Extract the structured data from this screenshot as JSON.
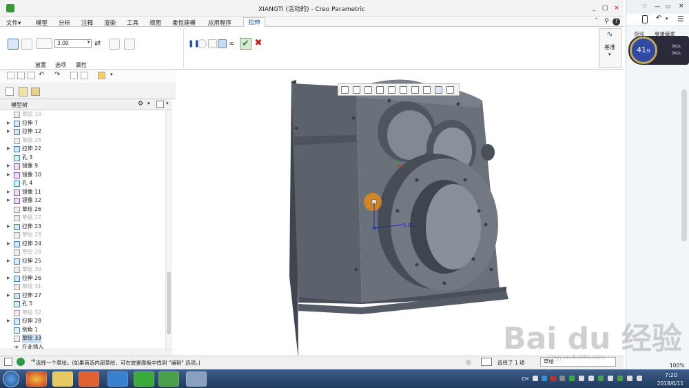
{
  "window": {
    "title": "XIANGTI (活动的) - Creo Parametric",
    "min": "_",
    "max": "□",
    "close": "×"
  },
  "menu": {
    "file": "文件▾",
    "tabs": [
      "模型",
      "分析",
      "注释",
      "渲染",
      "工具",
      "视图",
      "柔性建模",
      "应用程序"
    ],
    "active_tab": "拉伸",
    "help_icon": "question-icon",
    "search_icon": "search-icon"
  },
  "ribbon": {
    "depth_value": "3.00",
    "subtabs": [
      "放置",
      "选项",
      "属性"
    ],
    "datum_label": "基准",
    "datum_arrow": "▾",
    "ok_color": "#2a8a2a",
    "cancel_color": "#cc1111"
  },
  "tree": {
    "title": "模型树",
    "rows": [
      {
        "label": "草绘 10",
        "type": "sketch",
        "dim": true,
        "exp": ""
      },
      {
        "label": "拉伸 7",
        "type": "extrude",
        "dim": false,
        "exp": "▶"
      },
      {
        "label": "拉伸 12",
        "type": "extrude",
        "dim": false,
        "exp": "▶"
      },
      {
        "label": "草绘 25",
        "type": "sketch",
        "dim": true,
        "exp": ""
      },
      {
        "label": "拉伸 22",
        "type": "extrude",
        "dim": false,
        "exp": "▶"
      },
      {
        "label": "孔 3",
        "type": "hole",
        "dim": false,
        "exp": ""
      },
      {
        "label": "镜像 9",
        "type": "mirror",
        "dim": false,
        "exp": "▶"
      },
      {
        "label": "镜像 10",
        "type": "mirror",
        "dim": false,
        "exp": "▶"
      },
      {
        "label": "孔 4",
        "type": "hole",
        "dim": false,
        "exp": ""
      },
      {
        "label": "镜像 11",
        "type": "mirror",
        "dim": false,
        "exp": "▶"
      },
      {
        "label": "镜像 12",
        "type": "mirror",
        "dim": false,
        "exp": "▶"
      },
      {
        "label": "草绘 26",
        "type": "sketch",
        "dim": false,
        "exp": ""
      },
      {
        "label": "草绘 27",
        "type": "sketch",
        "dim": true,
        "exp": ""
      },
      {
        "label": "拉伸 23",
        "type": "extrude",
        "dim": false,
        "exp": "▶"
      },
      {
        "label": "草绘 28",
        "type": "sketch",
        "dim": true,
        "exp": ""
      },
      {
        "label": "拉伸 24",
        "type": "extrude",
        "dim": false,
        "exp": "▶"
      },
      {
        "label": "草绘 29",
        "type": "sketch",
        "dim": true,
        "exp": ""
      },
      {
        "label": "拉伸 25",
        "type": "extrude",
        "dim": false,
        "exp": "▶"
      },
      {
        "label": "草绘 30",
        "type": "sketch",
        "dim": true,
        "exp": ""
      },
      {
        "label": "拉伸 26",
        "type": "extrude",
        "dim": false,
        "exp": "▶"
      },
      {
        "label": "草绘 31",
        "type": "sketch",
        "dim": true,
        "exp": ""
      },
      {
        "label": "拉伸 27",
        "type": "extrude",
        "dim": false,
        "exp": "▶"
      },
      {
        "label": "孔 5",
        "type": "hole",
        "dim": false,
        "exp": ""
      },
      {
        "label": "草绘 32",
        "type": "sketch",
        "dim": true,
        "exp": ""
      },
      {
        "label": "拉伸 28",
        "type": "extrude",
        "dim": false,
        "exp": "▶"
      },
      {
        "label": "倒角 1",
        "type": "hole",
        "dim": false,
        "exp": ""
      },
      {
        "label": "草绘 33",
        "type": "sketch",
        "dim": false,
        "exp": "",
        "selected": true
      },
      {
        "label": "在此插入",
        "type": "insert",
        "dim": false,
        "exp": ""
      }
    ]
  },
  "canvas": {
    "dimension_value": "3.00"
  },
  "status": {
    "message": "选择一个草绘。(如果首选内部草绘，可在放置面板中找到 \"编辑\" 选项。)",
    "selected": "选择了 1 项",
    "filter": "草绘"
  },
  "sidepanel": {
    "game": "游戏",
    "login": "登录管家",
    "widget_value": "41",
    "widget_unit": "分",
    "speed_up": "0K/s",
    "speed_down": "0K/s",
    "zoom": "100%"
  },
  "taskbar": {
    "time": "7:20",
    "date": "2018/6/11",
    "lang": "CH"
  },
  "watermark": {
    "text": "Bai du 经验",
    "url": "jingyan.baidu.com"
  }
}
